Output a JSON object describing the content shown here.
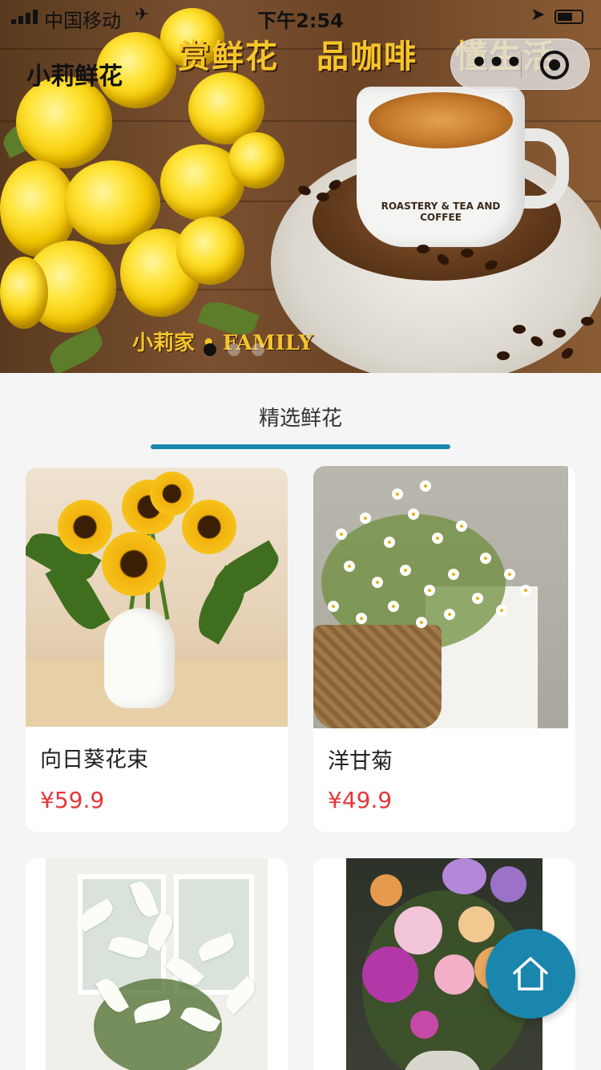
{
  "status_bar": {
    "carrier": "中国移动",
    "time": "下午2:54"
  },
  "header": {
    "title": "小莉鲜花",
    "capsule": {
      "more_icon": "more-dots-icon",
      "close_icon": "target-circle-icon"
    }
  },
  "banner": {
    "slogan": [
      "赏鲜花",
      "品咖啡",
      "懂生活"
    ],
    "brand_text": "小莉家 • FAMILY",
    "cup_text": "ROASTERY & TEA AND COFFEE",
    "slides": 3,
    "active_slide": 1
  },
  "tab": {
    "label": "精选鲜花"
  },
  "products": [
    {
      "name": "向日葵花束",
      "price": "¥59.9"
    },
    {
      "name": "洋甘菊",
      "price": "¥49.9"
    },
    {
      "name": "",
      "price": ""
    },
    {
      "name": "",
      "price": ""
    }
  ],
  "fab": {
    "icon": "home-icon",
    "color": "#1b86ad"
  },
  "colors": {
    "accent": "#1b86ad",
    "price": "#e8363a"
  }
}
